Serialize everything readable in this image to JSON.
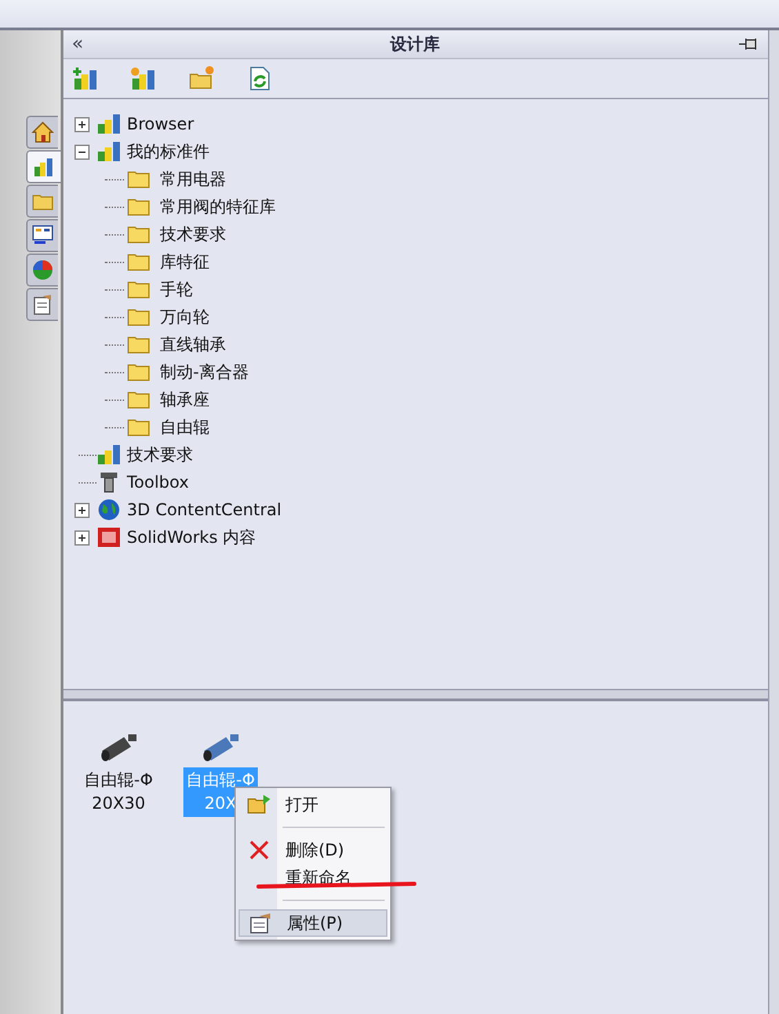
{
  "panel": {
    "title": "设计库",
    "collapse": "«"
  },
  "toolbar": [
    {
      "kind": "add-library"
    },
    {
      "kind": "new-library"
    },
    {
      "kind": "new-folder"
    },
    {
      "kind": "refresh"
    }
  ],
  "side_tabs": [
    {
      "kind": "home",
      "selected": false
    },
    {
      "kind": "library",
      "selected": true
    },
    {
      "kind": "folder",
      "selected": false
    },
    {
      "kind": "palette",
      "selected": false
    },
    {
      "kind": "appearance",
      "selected": false
    },
    {
      "kind": "properties",
      "selected": false
    }
  ],
  "tree": [
    {
      "label": "Browser",
      "kind": "library",
      "expanded": false
    },
    {
      "label": "我的标准件",
      "kind": "library",
      "expanded": true,
      "children": [
        {
          "label": "常用电器",
          "kind": "folder"
        },
        {
          "label": "常用阀的特征库",
          "kind": "folder"
        },
        {
          "label": "技术要求",
          "kind": "folder"
        },
        {
          "label": "库特征",
          "kind": "folder"
        },
        {
          "label": "手轮",
          "kind": "folder"
        },
        {
          "label": "万向轮",
          "kind": "folder"
        },
        {
          "label": "直线轴承",
          "kind": "folder"
        },
        {
          "label": "制动-离合器",
          "kind": "folder"
        },
        {
          "label": "轴承座",
          "kind": "folder"
        },
        {
          "label": "自由辊",
          "kind": "folder"
        }
      ]
    },
    {
      "label": "技术要求",
      "kind": "library"
    },
    {
      "label": "Toolbox",
      "kind": "tool"
    },
    {
      "label": "3D ContentCentral",
      "kind": "globe",
      "expanded": false
    },
    {
      "label": "SolidWorks 内容",
      "kind": "sw",
      "expanded": false
    }
  ],
  "files": [
    {
      "lines": [
        "自由辊-Φ",
        "20X30"
      ],
      "selected": false,
      "color": "#444444"
    },
    {
      "lines": [
        "自由辊-Φ",
        "20X"
      ],
      "selected": true,
      "color": "#4a78b8"
    }
  ],
  "context_menu": [
    {
      "kind": "open",
      "label": "打开",
      "hovered": false
    },
    {
      "kind": "separator"
    },
    {
      "kind": "delete",
      "label": "删除(D)",
      "hovered": false
    },
    {
      "kind": "rename",
      "label": "重新命名",
      "hovered": false
    },
    {
      "kind": "separator"
    },
    {
      "kind": "properties",
      "label": "属性(P)",
      "hovered": true
    }
  ]
}
